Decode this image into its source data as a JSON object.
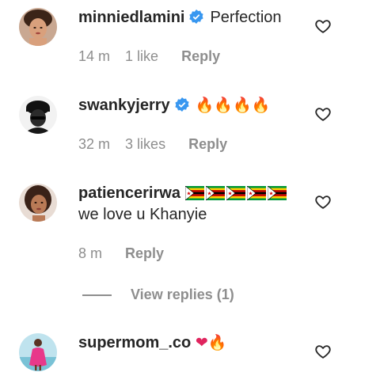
{
  "comments": [
    {
      "username": "minniedlamini",
      "verified": true,
      "text": "Perfection",
      "time": "14 m",
      "likes": "1 like",
      "reply": "Reply",
      "avatar_icon": "woman-portrait-avatar"
    },
    {
      "username": "swankyjerry",
      "verified": true,
      "emoji": "🔥🔥🔥🔥",
      "time": "32 m",
      "likes": "3 likes",
      "reply": "Reply",
      "avatar_icon": "man-with-cap-avatar"
    },
    {
      "username": "patiencerirwa",
      "verified": false,
      "flags": [
        "zimbabwe-flag",
        "zimbabwe-flag",
        "zimbabwe-flag",
        "zimbabwe-flag",
        "zimbabwe-flag"
      ],
      "text": "we love u Khanyie",
      "time": "8 m",
      "reply": "Reply",
      "avatar_icon": "woman-selfie-avatar"
    },
    {
      "username": "supermom_.co",
      "verified": false,
      "emoji": "❤🔥",
      "avatar_icon": "woman-pink-dress-avatar"
    }
  ],
  "view_replies": "View replies (1)",
  "colors": {
    "verified_blue": "#3897f0",
    "muted_text": "#8e8e8e",
    "primary_text": "#262626"
  }
}
